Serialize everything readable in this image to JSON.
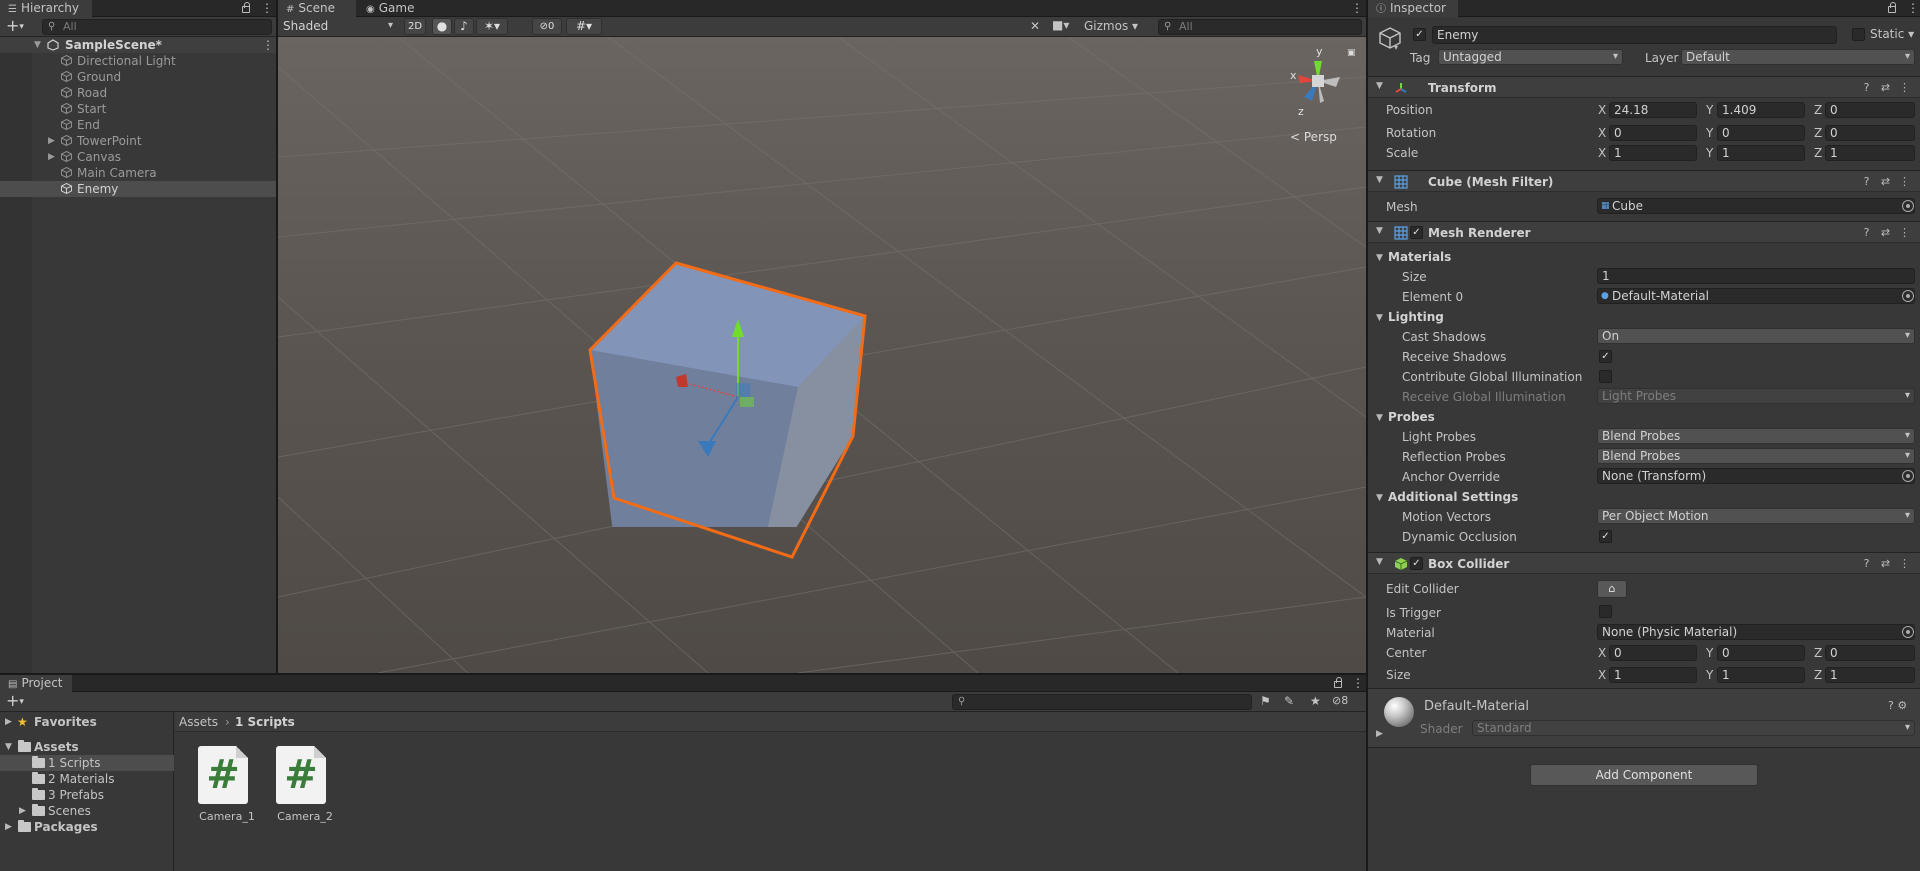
{
  "hierarchy": {
    "tab_label": "Hierarchy",
    "search_placeholder": "All",
    "scene_name": "SampleScene*",
    "items": [
      {
        "label": "Directional Light"
      },
      {
        "label": "Ground"
      },
      {
        "label": "Road"
      },
      {
        "label": "Start"
      },
      {
        "label": "End"
      },
      {
        "label": "TowerPoint"
      },
      {
        "label": "Canvas"
      },
      {
        "label": "Main Camera"
      },
      {
        "label": "Enemy"
      }
    ]
  },
  "scene_view": {
    "tabs": [
      {
        "label": "Scene"
      },
      {
        "label": "Game"
      }
    ],
    "shading_mode": "Shaded",
    "mode_2d_label": "2D",
    "hidden_count": "0",
    "gizmos_label": "Gizmos",
    "search_placeholder": "All",
    "projection_label": "Persp",
    "axis_labels": {
      "x": "x",
      "y": "y",
      "z": "z"
    }
  },
  "inspector": {
    "tab_label": "Inspector",
    "object_name": "Enemy",
    "static_label": "Static",
    "tag_label": "Tag",
    "tag_value": "Untagged",
    "layer_label": "Layer",
    "layer_value": "Default",
    "transform": {
      "title": "Transform",
      "position_label": "Position",
      "rotation_label": "Rotation",
      "scale_label": "Scale",
      "position": {
        "x": "24.18",
        "y": "1.409",
        "z": "0"
      },
      "rotation": {
        "x": "0",
        "y": "0",
        "z": "0"
      },
      "scale": {
        "x": "1",
        "y": "1",
        "z": "1"
      }
    },
    "mesh_filter": {
      "title": "Cube (Mesh Filter)",
      "mesh_label": "Mesh",
      "mesh_value": "Cube"
    },
    "mesh_renderer": {
      "title": "Mesh Renderer",
      "materials_label": "Materials",
      "size_label": "Size",
      "size_value": "1",
      "element0_label": "Element 0",
      "element0_value": "Default-Material",
      "lighting_label": "Lighting",
      "cast_shadows_label": "Cast Shadows",
      "cast_shadows_value": "On",
      "receive_shadows_label": "Receive Shadows",
      "contribute_gi_label": "Contribute Global Illumination",
      "receive_gi_label": "Receive Global Illumination",
      "receive_gi_value": "Light Probes",
      "probes_label": "Probes",
      "light_probes_label": "Light Probes",
      "light_probes_value": "Blend Probes",
      "reflection_probes_label": "Reflection Probes",
      "reflection_probes_value": "Blend Probes",
      "anchor_override_label": "Anchor Override",
      "anchor_override_value": "None (Transform)",
      "additional_label": "Additional Settings",
      "motion_vectors_label": "Motion Vectors",
      "motion_vectors_value": "Per Object Motion",
      "dynamic_occlusion_label": "Dynamic Occlusion"
    },
    "box_collider": {
      "title": "Box Collider",
      "edit_collider_label": "Edit Collider",
      "is_trigger_label": "Is Trigger",
      "material_label": "Material",
      "material_value": "None (Physic Material)",
      "center_label": "Center",
      "center": {
        "x": "0",
        "y": "0",
        "z": "0"
      },
      "size_label": "Size",
      "size": {
        "x": "1",
        "y": "1",
        "z": "1"
      }
    },
    "material": {
      "name": "Default-Material",
      "shader_label": "Shader",
      "shader_value": "Standard"
    },
    "add_component_label": "Add Component",
    "axis_x": "X",
    "axis_y": "Y",
    "axis_z": "Z"
  },
  "project": {
    "tab_label": "Project",
    "hidden_count": "8",
    "favorites_label": "Favorites",
    "assets_label": "Assets",
    "folders": [
      {
        "label": "1 Scripts"
      },
      {
        "label": "2 Materials"
      },
      {
        "label": "3 Prefabs"
      },
      {
        "label": "Scenes"
      }
    ],
    "packages_label": "Packages",
    "breadcrumb": {
      "root": "Assets",
      "current": "1 Scripts"
    },
    "files": [
      {
        "name": "Camera_1"
      },
      {
        "name": "Camera_2"
      }
    ]
  },
  "colors": {
    "selection_outline": "#f26b16",
    "script_hash": "#3a7c3a",
    "accent_blue": "#3a79bb"
  }
}
